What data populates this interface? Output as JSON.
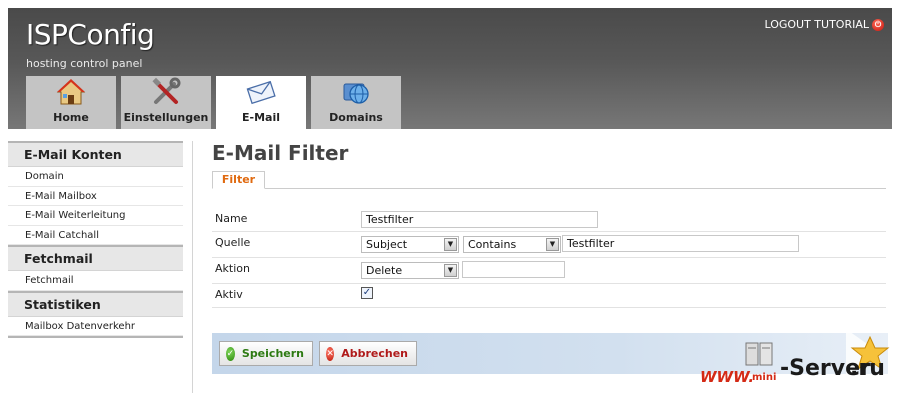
{
  "header": {
    "logo": "ISPConfig",
    "tagline": "hosting control panel",
    "logout": "LOGOUT TUTORIAL",
    "tabs": [
      {
        "label": "Home",
        "icon": "house-icon"
      },
      {
        "label": "Einstellungen",
        "icon": "tools-icon"
      },
      {
        "label": "E-Mail",
        "icon": "envelope-icon",
        "active": true
      },
      {
        "label": "Domains",
        "icon": "globe-icon"
      }
    ]
  },
  "sidebar": {
    "sections": [
      {
        "title": "E-Mail Konten",
        "items": [
          "Domain",
          "E-Mail Mailbox",
          "E-Mail Weiterleitung",
          "E-Mail Catchall"
        ]
      },
      {
        "title": "Fetchmail",
        "items": [
          "Fetchmail"
        ]
      },
      {
        "title": "Statistiken",
        "items": [
          "Mailbox Datenverkehr"
        ]
      }
    ]
  },
  "main": {
    "title": "E-Mail Filter",
    "form_tab": "Filter",
    "fields": {
      "name": {
        "label": "Name",
        "value": "Testfilter"
      },
      "quelle": {
        "label": "Quelle",
        "source": "Subject",
        "operator": "Contains",
        "value": "Testfilter"
      },
      "aktion": {
        "label": "Aktion",
        "action": "Delete",
        "target": ""
      },
      "aktiv": {
        "label": "Aktiv",
        "checked": true,
        "check_glyph": "✓"
      }
    },
    "buttons": {
      "save": "Speichern",
      "cancel": "Abbrechen"
    }
  },
  "watermark": {
    "www": "WWW.",
    "mini": "mini",
    "server": "-Server",
    "ru": ".ru"
  },
  "colors": {
    "accent_orange": "#e06a10",
    "save_green": "#2d7a12",
    "cancel_red": "#b01a1a"
  }
}
